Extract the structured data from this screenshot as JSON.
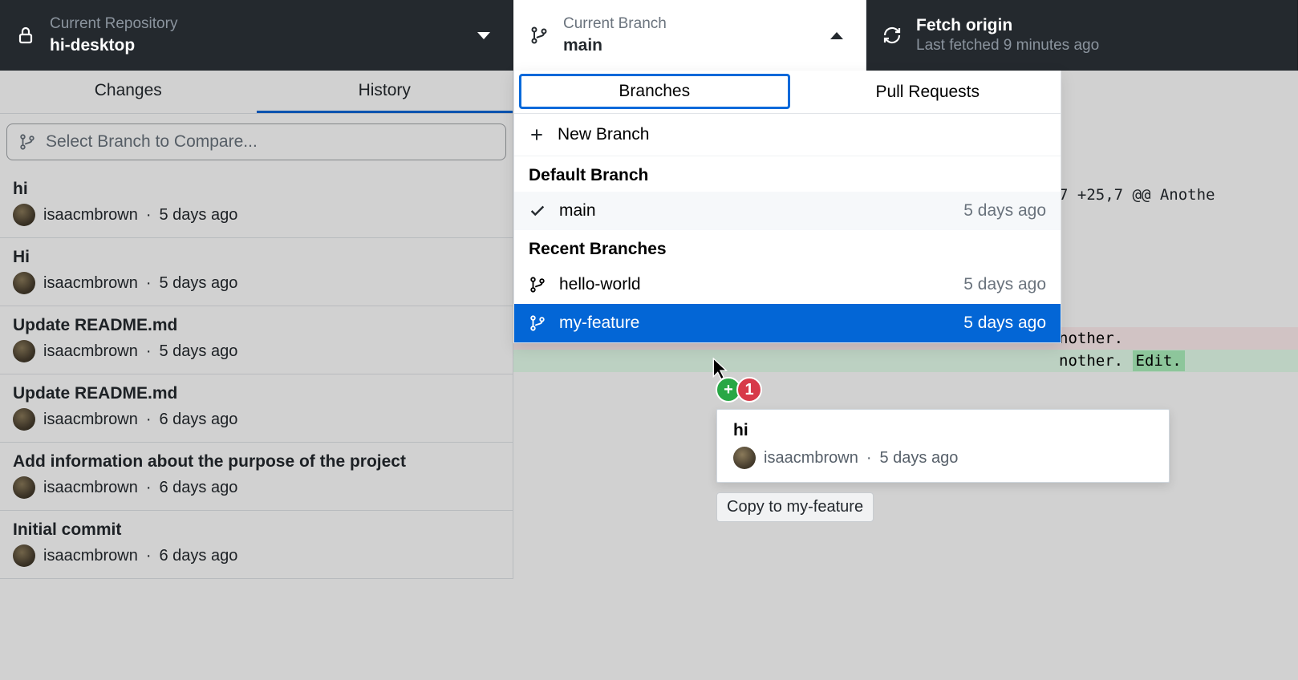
{
  "topbar": {
    "repo_label": "Current Repository",
    "repo_name": "hi-desktop",
    "branch_label": "Current Branch",
    "branch_name": "main",
    "fetch_label": "Fetch origin",
    "fetch_status": "Last fetched 9 minutes ago"
  },
  "left_tabs": {
    "changes": "Changes",
    "history": "History"
  },
  "compare_placeholder": "Select Branch to Compare...",
  "commits": [
    {
      "title": "hi",
      "author": "isaacmbrown",
      "time": "5 days ago"
    },
    {
      "title": "Hi",
      "author": "isaacmbrown",
      "time": "5 days ago"
    },
    {
      "title": "Update README.md",
      "author": "isaacmbrown",
      "time": "5 days ago"
    },
    {
      "title": "Update README.md",
      "author": "isaacmbrown",
      "time": "6 days ago"
    },
    {
      "title": "Add information about the purpose of the project",
      "author": "isaacmbrown",
      "time": "6 days ago"
    },
    {
      "title": "Initial commit",
      "author": "isaacmbrown",
      "time": "6 days ago"
    }
  ],
  "diff": {
    "hunk": "7 +25,7 @@ Anothe",
    "line_del": "nother.",
    "line_add_prefix": "nother.",
    "line_add_word": "Edit."
  },
  "branch_panel": {
    "tab_branches": "Branches",
    "tab_prs": "Pull Requests",
    "new_branch": "New Branch",
    "default_header": "Default Branch",
    "recent_header": "Recent Branches",
    "branches": {
      "default": {
        "name": "main",
        "time": "5 days ago"
      },
      "recent": [
        {
          "name": "hello-world",
          "time": "5 days ago"
        },
        {
          "name": "my-feature",
          "time": "5 days ago"
        }
      ]
    }
  },
  "drag": {
    "count": "1",
    "card": {
      "title": "hi",
      "author": "isaacmbrown",
      "time": "5 days ago"
    },
    "tooltip": "Copy to my-feature"
  }
}
